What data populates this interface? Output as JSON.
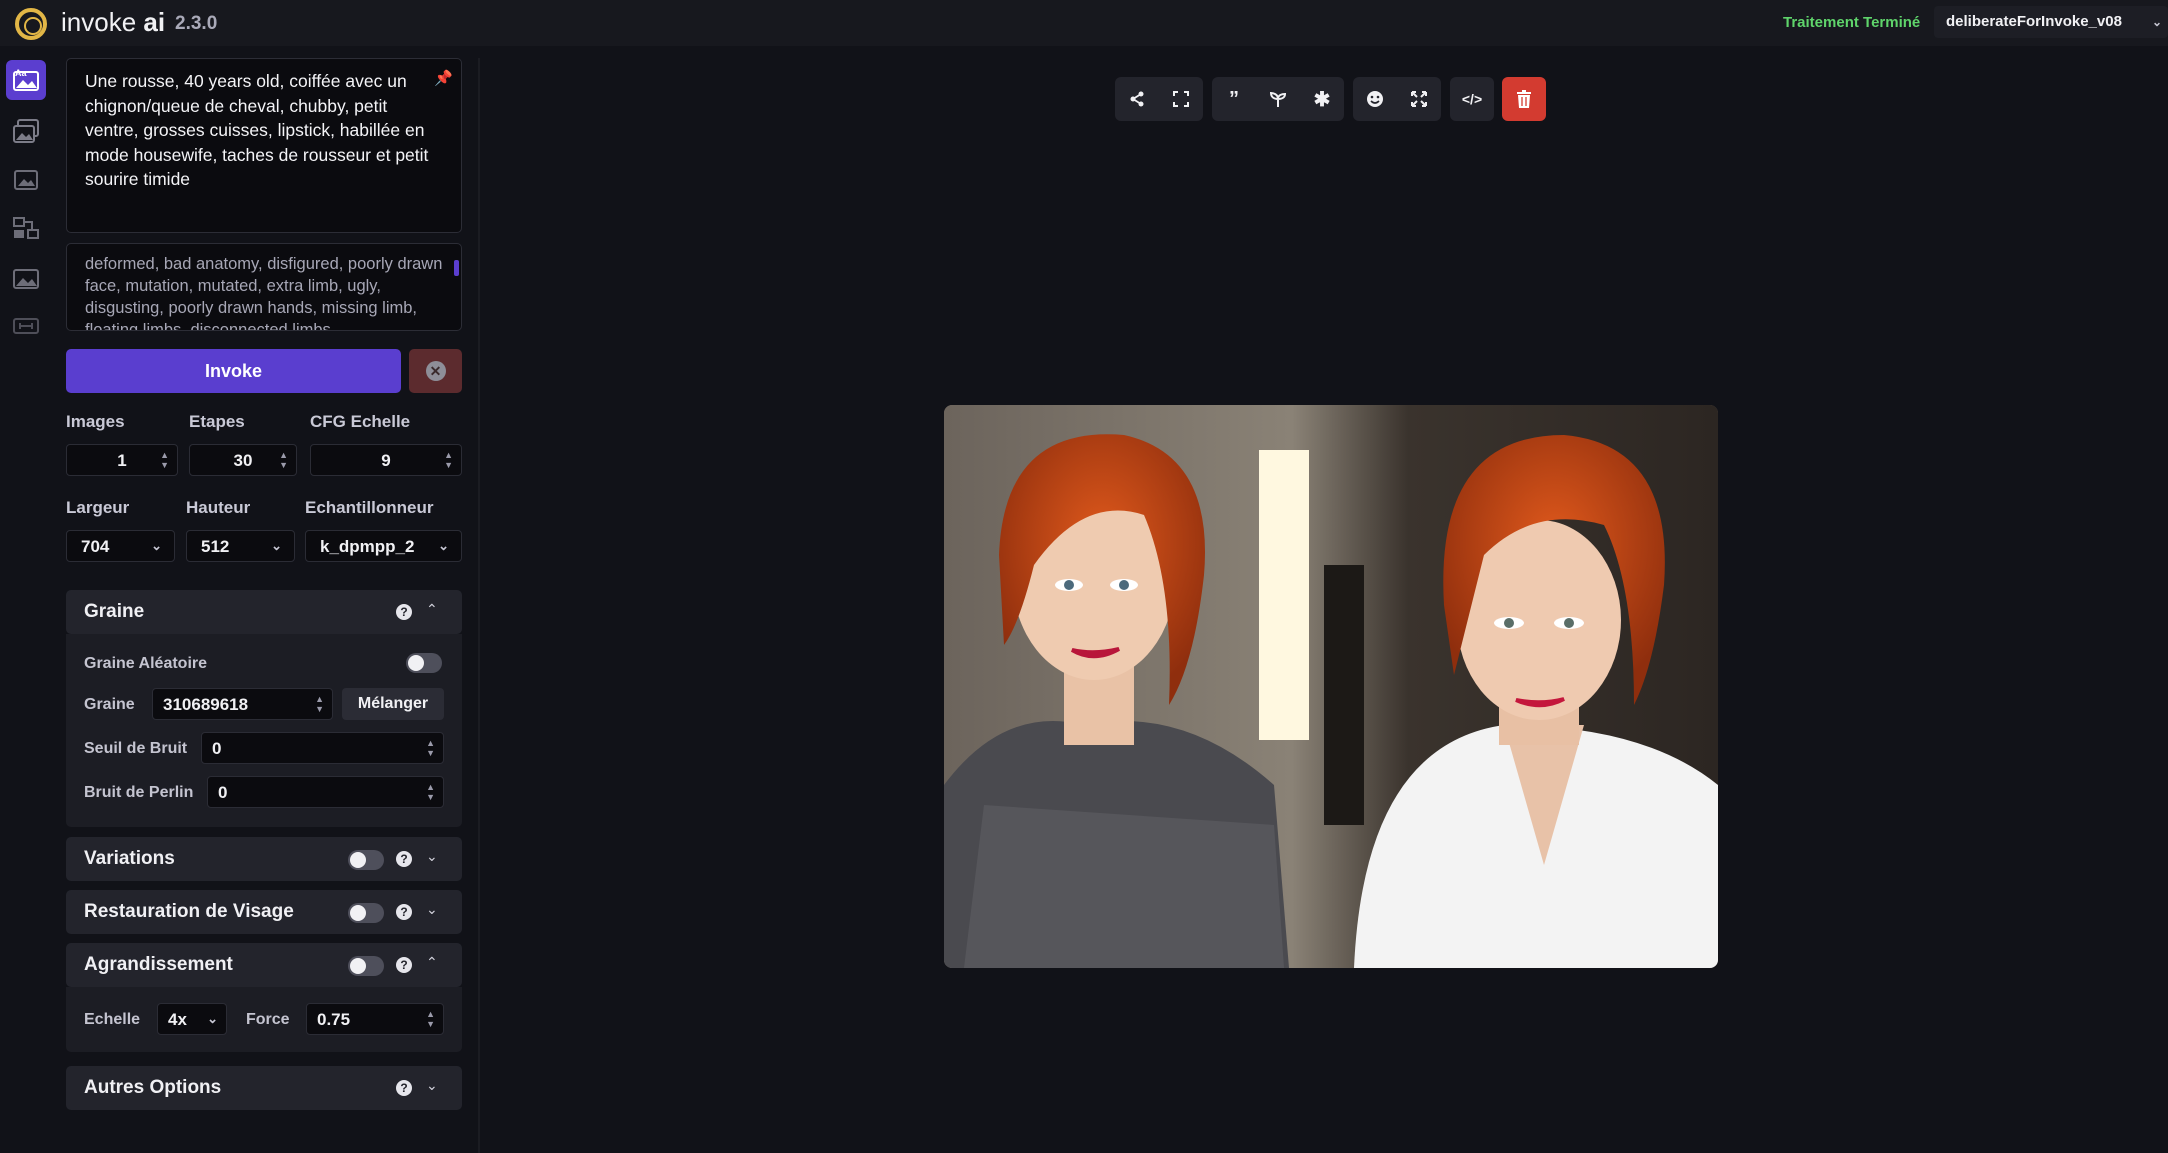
{
  "header": {
    "brand_name": "invoke",
    "brand_suffix": "ai",
    "version": "2.3.0",
    "status": "Traitement Terminé",
    "model": "deliberateForInvoke_v08"
  },
  "rail": {
    "items": [
      "text-to-image",
      "image-to-image",
      "unified-canvas",
      "nodes",
      "model-manager",
      "merge-models"
    ]
  },
  "prompt": {
    "positive": "Une rousse, 40 years old, coiffée avec un chignon/queue de cheval, chubby, petit ventre, grosses cuisses, lipstick, habillée en mode housewife, taches de rousseur et petit sourire timide",
    "negative": "deformed, bad anatomy, disfigured, poorly drawn face, mutation, mutated, extra limb, ugly, disgusting, poorly drawn hands, missing limb, floating limbs, disconnected limbs"
  },
  "actions": {
    "invoke_label": "Invoke",
    "cancel_symbol": "✕"
  },
  "params": {
    "images_label": "Images",
    "images_value": "1",
    "steps_label": "Etapes",
    "steps_value": "30",
    "cfg_label": "CFG Echelle",
    "cfg_value": "9",
    "width_label": "Largeur",
    "width_value": "704",
    "height_label": "Hauteur",
    "height_value": "512",
    "sampler_label": "Echantillonneur",
    "sampler_value": "k_dpmpp_2"
  },
  "seed": {
    "title": "Graine",
    "random_label": "Graine Aléatoire",
    "seed_label": "Graine",
    "seed_value": "310689618",
    "shuffle_label": "Mélanger",
    "threshold_label": "Seuil de Bruit",
    "threshold_value": "0",
    "perlin_label": "Bruit de Perlin",
    "perlin_value": "0"
  },
  "sections": {
    "variations": "Variations",
    "face_restore": "Restauration de Visage",
    "upscale": "Agrandissement",
    "other": "Autres Options"
  },
  "upscale": {
    "scale_label": "Echelle",
    "scale_value": "4x",
    "strength_label": "Force",
    "strength_value": "0.75"
  },
  "help_symbol": "?",
  "colors": {
    "accent": "#5a3ecf",
    "status_green": "#5fd46b",
    "delete_red": "#d33b30",
    "panel_bg": "#111218"
  }
}
